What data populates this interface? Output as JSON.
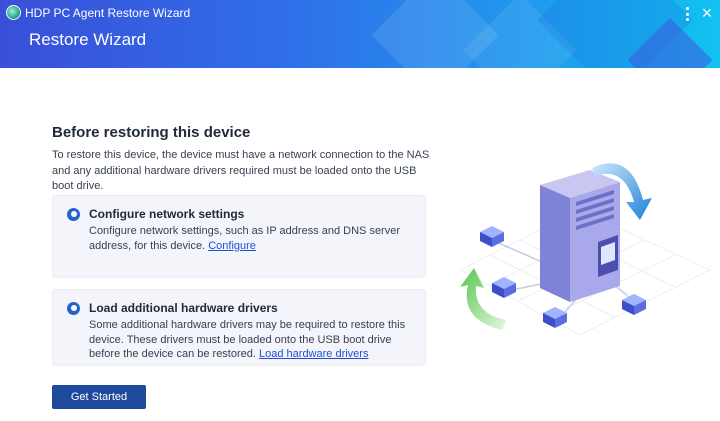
{
  "window": {
    "title": "HDP PC Agent Restore Wizard",
    "icon": "app-icon",
    "more_icon": "more-vertical-icon",
    "close_glyph": "×"
  },
  "header": {
    "heading": "Restore Wizard"
  },
  "main": {
    "section_title": "Before restoring this device",
    "intro": "To restore this device, the device must have a network connection to the NAS and any additional hardware drivers required must be loaded onto the USB boot drive.",
    "cards": [
      {
        "icon": "info-pin-icon",
        "title": "Configure network settings",
        "body": "Configure network settings, such as IP address and DNS server address, for this device.",
        "link": "Configure"
      },
      {
        "icon": "info-pin-icon",
        "title": "Load additional hardware drivers",
        "body": "Some additional hardware drivers may be required to restore this device. These drivers must be loaded onto the USB boot drive before the device can be restored.",
        "link": "Load hardware drivers"
      }
    ],
    "primary_button": "Get Started"
  },
  "colors": {
    "header_start": "#3a4fd9",
    "header_end": "#12c2f0",
    "button": "#1e4a9e",
    "link": "#1d4ed8",
    "card_bg": "#f3f5fa"
  }
}
